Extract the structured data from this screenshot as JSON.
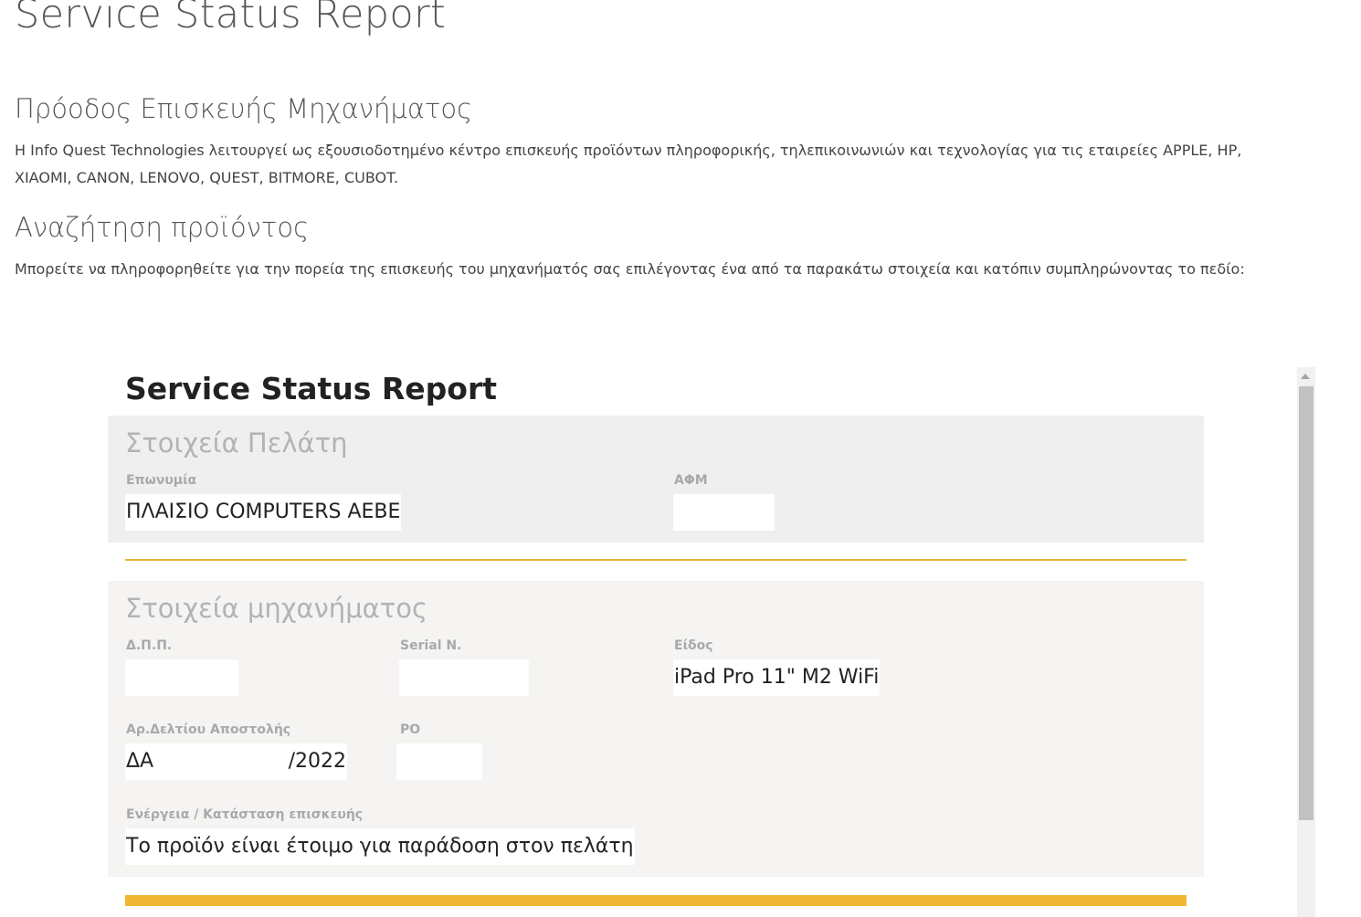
{
  "page": {
    "title": "Service Status Report",
    "progress_heading": "Πρόοδος Επισκευής Μηχανήματος",
    "intro_text": "Η Info Quest Technologies λειτουργεί ως εξουσιοδοτημένο κέντρο επισκευής προϊόντων πληροφορικής, τηλεπικοινωνιών και τεχνολογίας για τις εταιρείες APPLE, HP, XIAOMI, CANON, LENOVO, QUEST, BITMORE, CUBOT.",
    "search_heading": "Αναζήτηση προϊόντος",
    "search_text": "Μπορείτε να πληροφορηθείτε για την πορεία της επισκευής του μηχανήματός σας επιλέγοντας ένα από τα παρακάτω στοιχεία και κατόπιν συμπληρώνοντας το πεδίο:"
  },
  "report": {
    "title": "Service Status Report",
    "customer": {
      "heading": "Στοιχεία Πελάτη",
      "name_label": "Επωνυμία",
      "name_value": "ΠΛΑΙΣΙΟ COMPUTERS ΑΕΒΕ",
      "vat_label": "ΑΦΜ",
      "vat_value": ""
    },
    "device": {
      "heading": "Στοιχεία μηχανήματος",
      "dpp_label": "Δ.Π.Π.",
      "dpp_value": "",
      "serial_label": "Serial N.",
      "serial_value": "",
      "type_label": "Είδος",
      "type_value": "iPad Pro 11\" M2 WiFi",
      "delivery_label": "Αρ.Δελτίου Αποστολής",
      "delivery_prefix": "ΔΑ",
      "delivery_suffix": "/2022",
      "po_label": "PO",
      "po_value": "",
      "status_label": "Ενέργεια / Κατάσταση επισκευής",
      "status_value": "Το προϊόν είναι έτοιμο για παράδοση στον πελάτη"
    }
  },
  "colors": {
    "accent": "#f0b733",
    "card_customer_bg": "#efefef",
    "card_device_bg": "#f5f4f2",
    "heading_muted": "#b3b3b3"
  }
}
